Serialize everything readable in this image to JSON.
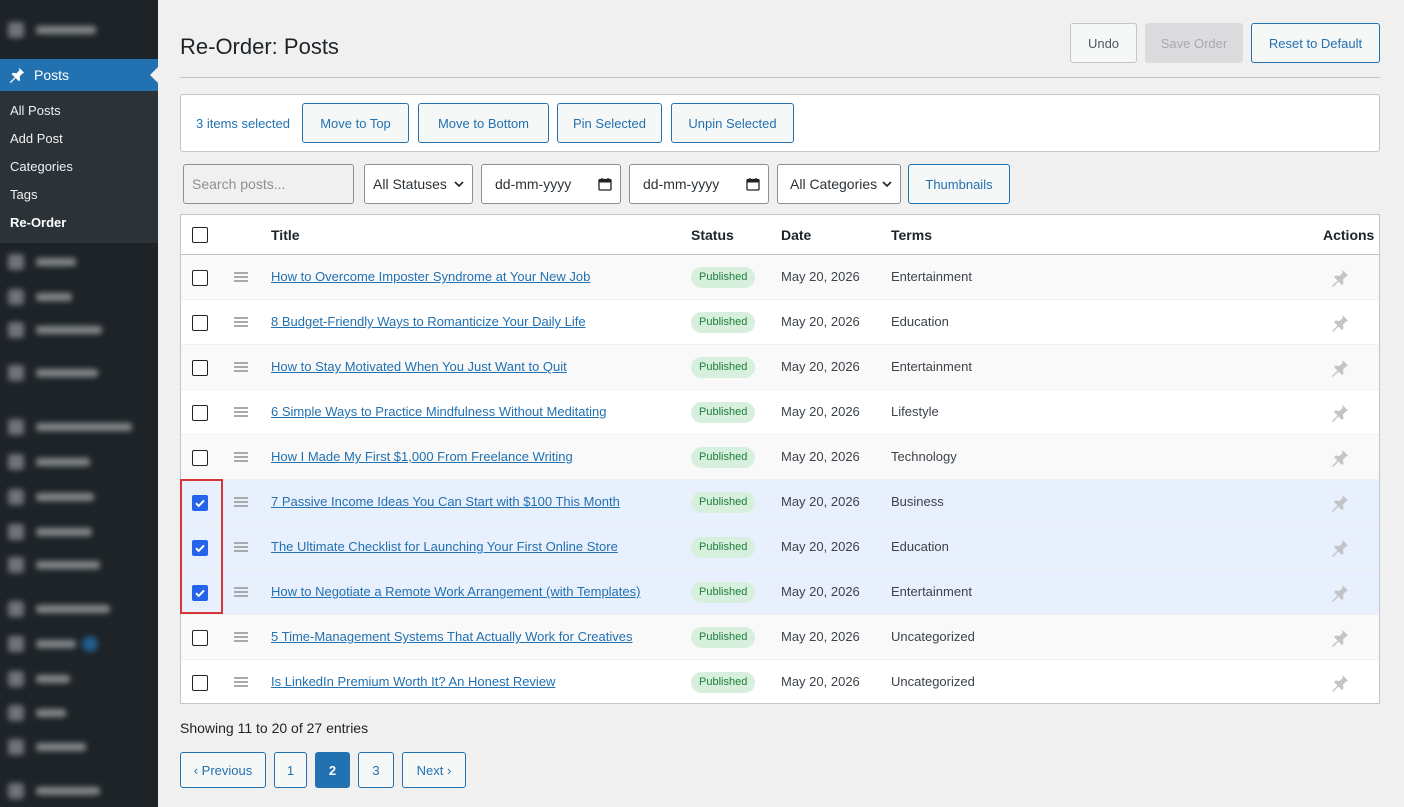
{
  "sidebar": {
    "active_menu": "Posts",
    "submenu": [
      {
        "label": "All Posts",
        "current": false
      },
      {
        "label": "Add Post",
        "current": false
      },
      {
        "label": "Categories",
        "current": false
      },
      {
        "label": "Tags",
        "current": false
      },
      {
        "label": "Re-Order",
        "current": true
      }
    ]
  },
  "header": {
    "title": "Re-Order: Posts",
    "undo_label": "Undo",
    "save_label": "Save Order",
    "reset_label": "Reset to Default"
  },
  "bulk": {
    "count_text": "3 items selected",
    "move_top": "Move to Top",
    "move_bottom": "Move to Bottom",
    "pin": "Pin Selected",
    "unpin": "Unpin Selected"
  },
  "filters": {
    "search_placeholder": "Search posts...",
    "status": "All Statuses",
    "date_from": "dd-mm-yyyy",
    "date_to": "dd-mm-yyyy",
    "category": "All Categories",
    "thumbnails": "Thumbnails"
  },
  "table": {
    "columns": {
      "title": "Title",
      "status": "Status",
      "date": "Date",
      "terms": "Terms",
      "actions": "Actions"
    },
    "rows": [
      {
        "title": "How to Overcome Imposter Syndrome at Your New Job",
        "status": "Published",
        "date": "May 20, 2026",
        "terms": "Entertainment",
        "checked": false
      },
      {
        "title": "8 Budget-Friendly Ways to Romanticize Your Daily Life",
        "status": "Published",
        "date": "May 20, 2026",
        "terms": "Education",
        "checked": false
      },
      {
        "title": "How to Stay Motivated When You Just Want to Quit",
        "status": "Published",
        "date": "May 20, 2026",
        "terms": "Entertainment",
        "checked": false
      },
      {
        "title": "6 Simple Ways to Practice Mindfulness Without Meditating",
        "status": "Published",
        "date": "May 20, 2026",
        "terms": "Lifestyle",
        "checked": false
      },
      {
        "title": "How I Made My First $1,000 From Freelance Writing",
        "status": "Published",
        "date": "May 20, 2026",
        "terms": "Technology",
        "checked": false
      },
      {
        "title": "7 Passive Income Ideas You Can Start with $100 This Month",
        "status": "Published",
        "date": "May 20, 2026",
        "terms": "Business",
        "checked": true
      },
      {
        "title": "The Ultimate Checklist for Launching Your First Online Store",
        "status": "Published",
        "date": "May 20, 2026",
        "terms": "Education",
        "checked": true
      },
      {
        "title": "How to Negotiate a Remote Work Arrangement (with Templates)",
        "status": "Published",
        "date": "May 20, 2026",
        "terms": "Entertainment",
        "checked": true
      },
      {
        "title": "5 Time-Management Systems That Actually Work for Creatives",
        "status": "Published",
        "date": "May 20, 2026",
        "terms": "Uncategorized",
        "checked": false
      },
      {
        "title": "Is LinkedIn Premium Worth It? An Honest Review",
        "status": "Published",
        "date": "May 20, 2026",
        "terms": "Uncategorized",
        "checked": false
      }
    ]
  },
  "pagination": {
    "showing": "Showing 11 to 20 of 27 entries",
    "prev": "‹ Previous",
    "pages": [
      "1",
      "2",
      "3"
    ],
    "current": "2",
    "next": "Next ›"
  },
  "colors": {
    "accent": "#2271b1",
    "checked": "#2563eb",
    "selected_row": "#e9f0fd",
    "badge_bg": "#d7f0de",
    "badge_text": "#1e7e3a",
    "highlight": "#d63638"
  }
}
